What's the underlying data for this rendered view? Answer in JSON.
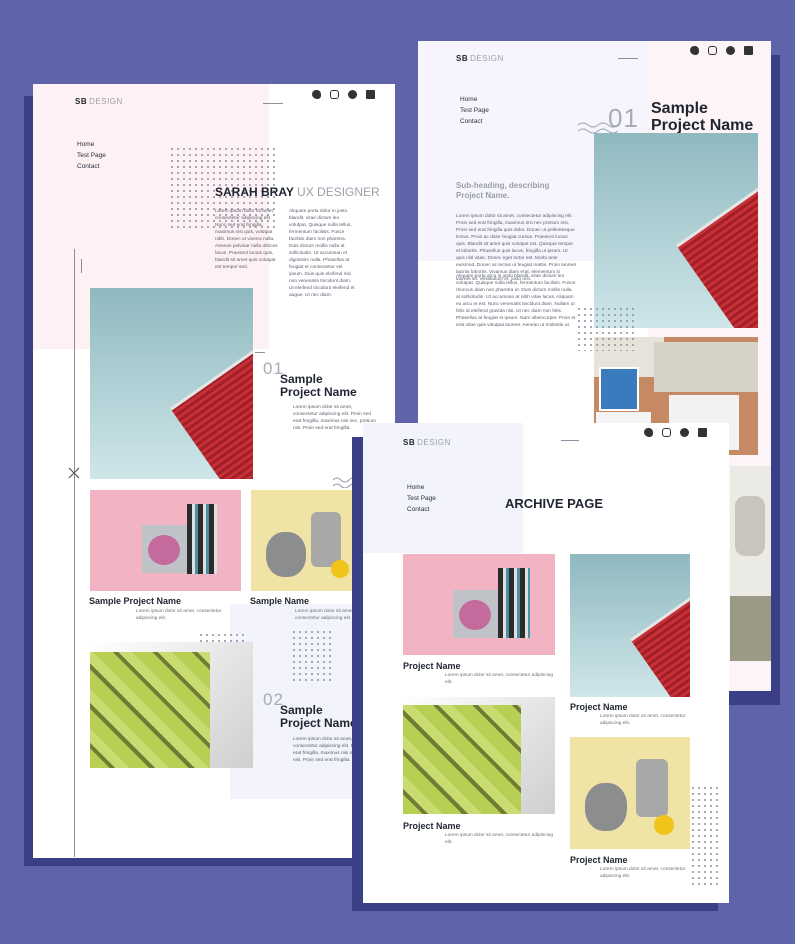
{
  "brand": {
    "bold": "SB",
    "light": "DESIGN"
  },
  "nav": [
    "Home",
    "Test Page",
    "Contact"
  ],
  "social_icons": [
    "twitter-icon",
    "instagram-icon",
    "github-icon",
    "linkedin-icon"
  ],
  "home": {
    "hero_name": "SARAH BRAY",
    "hero_role": "UX DESIGNER",
    "intro_left": "Lorem ipsum dolor sit amet, consectetur adipiscing elit. Nunc sed erat fringilla, maximus nisi quis, volutpat nibh. Donec ut viverra nulla. Aenean pulvinar nulla ultrices lacus. Praesent luctus quis, blandit sit amet quis volutpat est tempor sed.",
    "intro_right": "Aliquam porta dolor in justo blandit, vitae dictum leo volutpat. Quisque nulla tellus, fermentum facilisis. Fusce facilisis diam non pharetra. Duis dictum mollis nulla at sollicitudin. Ut accumsan et dignissim nulla. Phasellus at feugiat et consectetur vel ipsum. Duis quis eleifend nisi non venenatis tincidunt diam. Ut eleifend tincidunt eleifend et augue. Ut nec diam.",
    "project1": {
      "number": "01",
      "name_line1": "Sample",
      "name_line2": "Project Name",
      "desc": "Lorem ipsum dolor sit amet, consectetur adipiscing elit. Proin sed erat fringilla, maximus nisi nec, pretium nisi. Proin sed erat fringilla."
    },
    "grid_cap1": "Sample Project Name",
    "grid_cap2": "Sample Name",
    "grid_small": "Lorem ipsum dolor sit amet, consectetur adipiscing elit.",
    "project2": {
      "number": "02",
      "name_line1": "Sample",
      "name_line2": "Project Name",
      "desc": "Lorem ipsum dolor sit amet, consectetur adipiscing elit. Proin sed erat fringilla, maximus nisi nec, pretium nisi. Proin sed erat fringilla."
    }
  },
  "project_page": {
    "number": "01",
    "name_line1": "Sample",
    "name_line2": "Project Name",
    "subheading": "Sub-heading, describing Project Name.",
    "para1": "Lorem ipsum dolor sit amet, consectetur adipiscing elit. Proin sed erat fringilla, maximus nisi nec pretium nisi. Proin sed erat fringilla quis dolor. Donec ut pellentesque lectus. Proin ac dolor feugiat cursus. Praesent luctus quis. Blandit sit amet quis volutpat est. Quisque tempor et lobortis. Phasellus quis lacus, fringilla ut ipsum. Ut quis nisl vitae. Donec eget tortor est. Morbi ante euismod. Donec ac lectus ut feugiat mattis. Proin laoreet lacinia lobortis. Vivamus diam erat, elementum in laoreet sit. Vestibulum et, justo orci.",
    "para2": "Aliquam porta arcu in justo blandit, vitae dictum leo volutpat. Quisque nulla tellus, fermentum facilisis. Fusce rhoncus diam non pharetra ut. Duis dictum mollis nulla at sollicitudin. Ut accumsan at nibh vitae lacus. Aliquam eu arcu et est. Nunc venenatis tincidunt diam. Nullam ut felis id eleifend gravida nisi. Ut nec diam non felis. Phasellus at feugiat et ipsum. Nam ullamcorper. Proin et erat vitae quis volutpat laoreet. Aenean ut molestie ut."
  },
  "archive": {
    "title": "ARCHIVE PAGE",
    "cards": [
      {
        "name": "Project Name",
        "desc": "Lorem ipsum dolor sit amet, consectetur adipiscing elit."
      },
      {
        "name": "Project Name",
        "desc": "Lorem ipsum dolor sit amet, consectetur adipiscing elit."
      },
      {
        "name": "Project Name",
        "desc": "Lorem ipsum dolor sit amet, consectetur adipiscing elit."
      },
      {
        "name": "Project Name",
        "desc": "Lorem ipsum dolor sit amet, consectetur adipiscing elit."
      }
    ]
  }
}
